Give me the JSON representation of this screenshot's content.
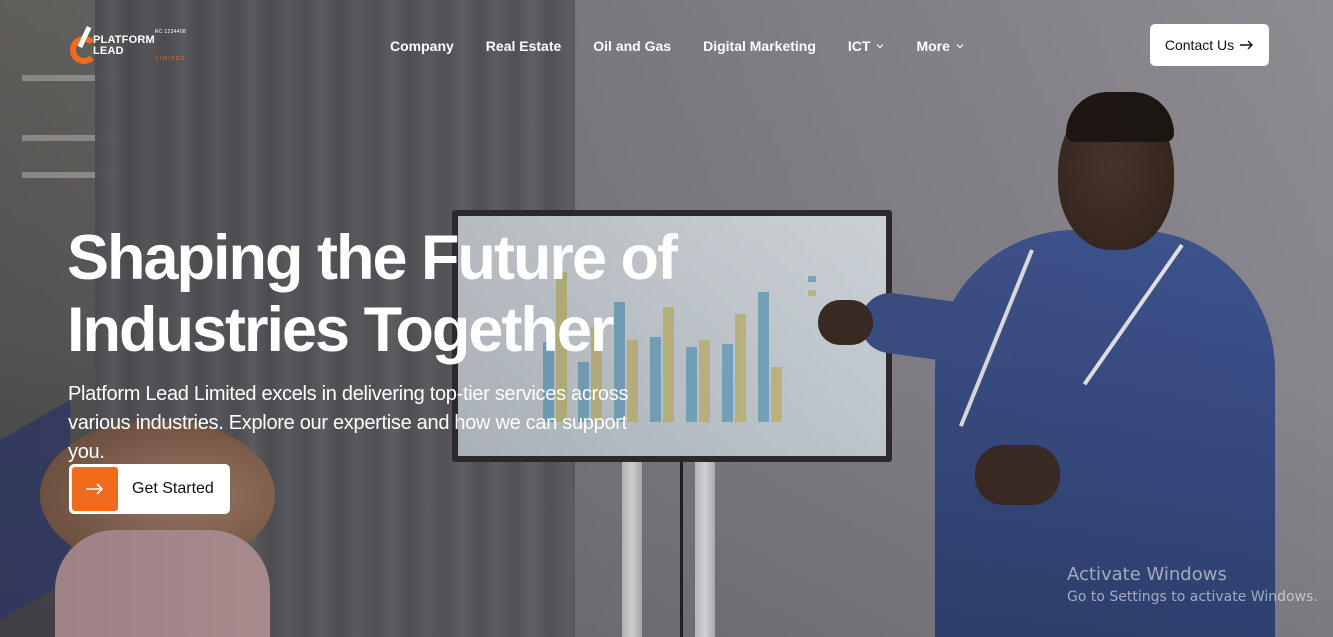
{
  "brand": {
    "name": "PLATFORM LEAD",
    "sub": "LIMITED",
    "rc": "RC 1234408",
    "accent_color": "#f26b1d"
  },
  "nav": {
    "items": [
      {
        "label": "Company",
        "has_dropdown": false
      },
      {
        "label": "Real Estate",
        "has_dropdown": false
      },
      {
        "label": "Oil and Gas",
        "has_dropdown": false
      },
      {
        "label": "Digital Marketing",
        "has_dropdown": false
      },
      {
        "label": "ICT",
        "has_dropdown": true
      },
      {
        "label": "More",
        "has_dropdown": true
      }
    ],
    "contact_label": "Contact Us",
    "contact_icon": "arrow-right-icon"
  },
  "hero": {
    "headline_line1": "Shaping the Future of",
    "headline_line2": "Industries Together",
    "subtext_line1": "Platform Lead Limited excels in delivering top-tier services across",
    "subtext_line2": "various industries. Explore our expertise and how we can support you.",
    "cta_label": "Get Started",
    "cta_icon": "arrow-right-icon"
  },
  "watermark": {
    "title": "Activate Windows",
    "subtitle": "Go to Settings to activate Windows."
  }
}
